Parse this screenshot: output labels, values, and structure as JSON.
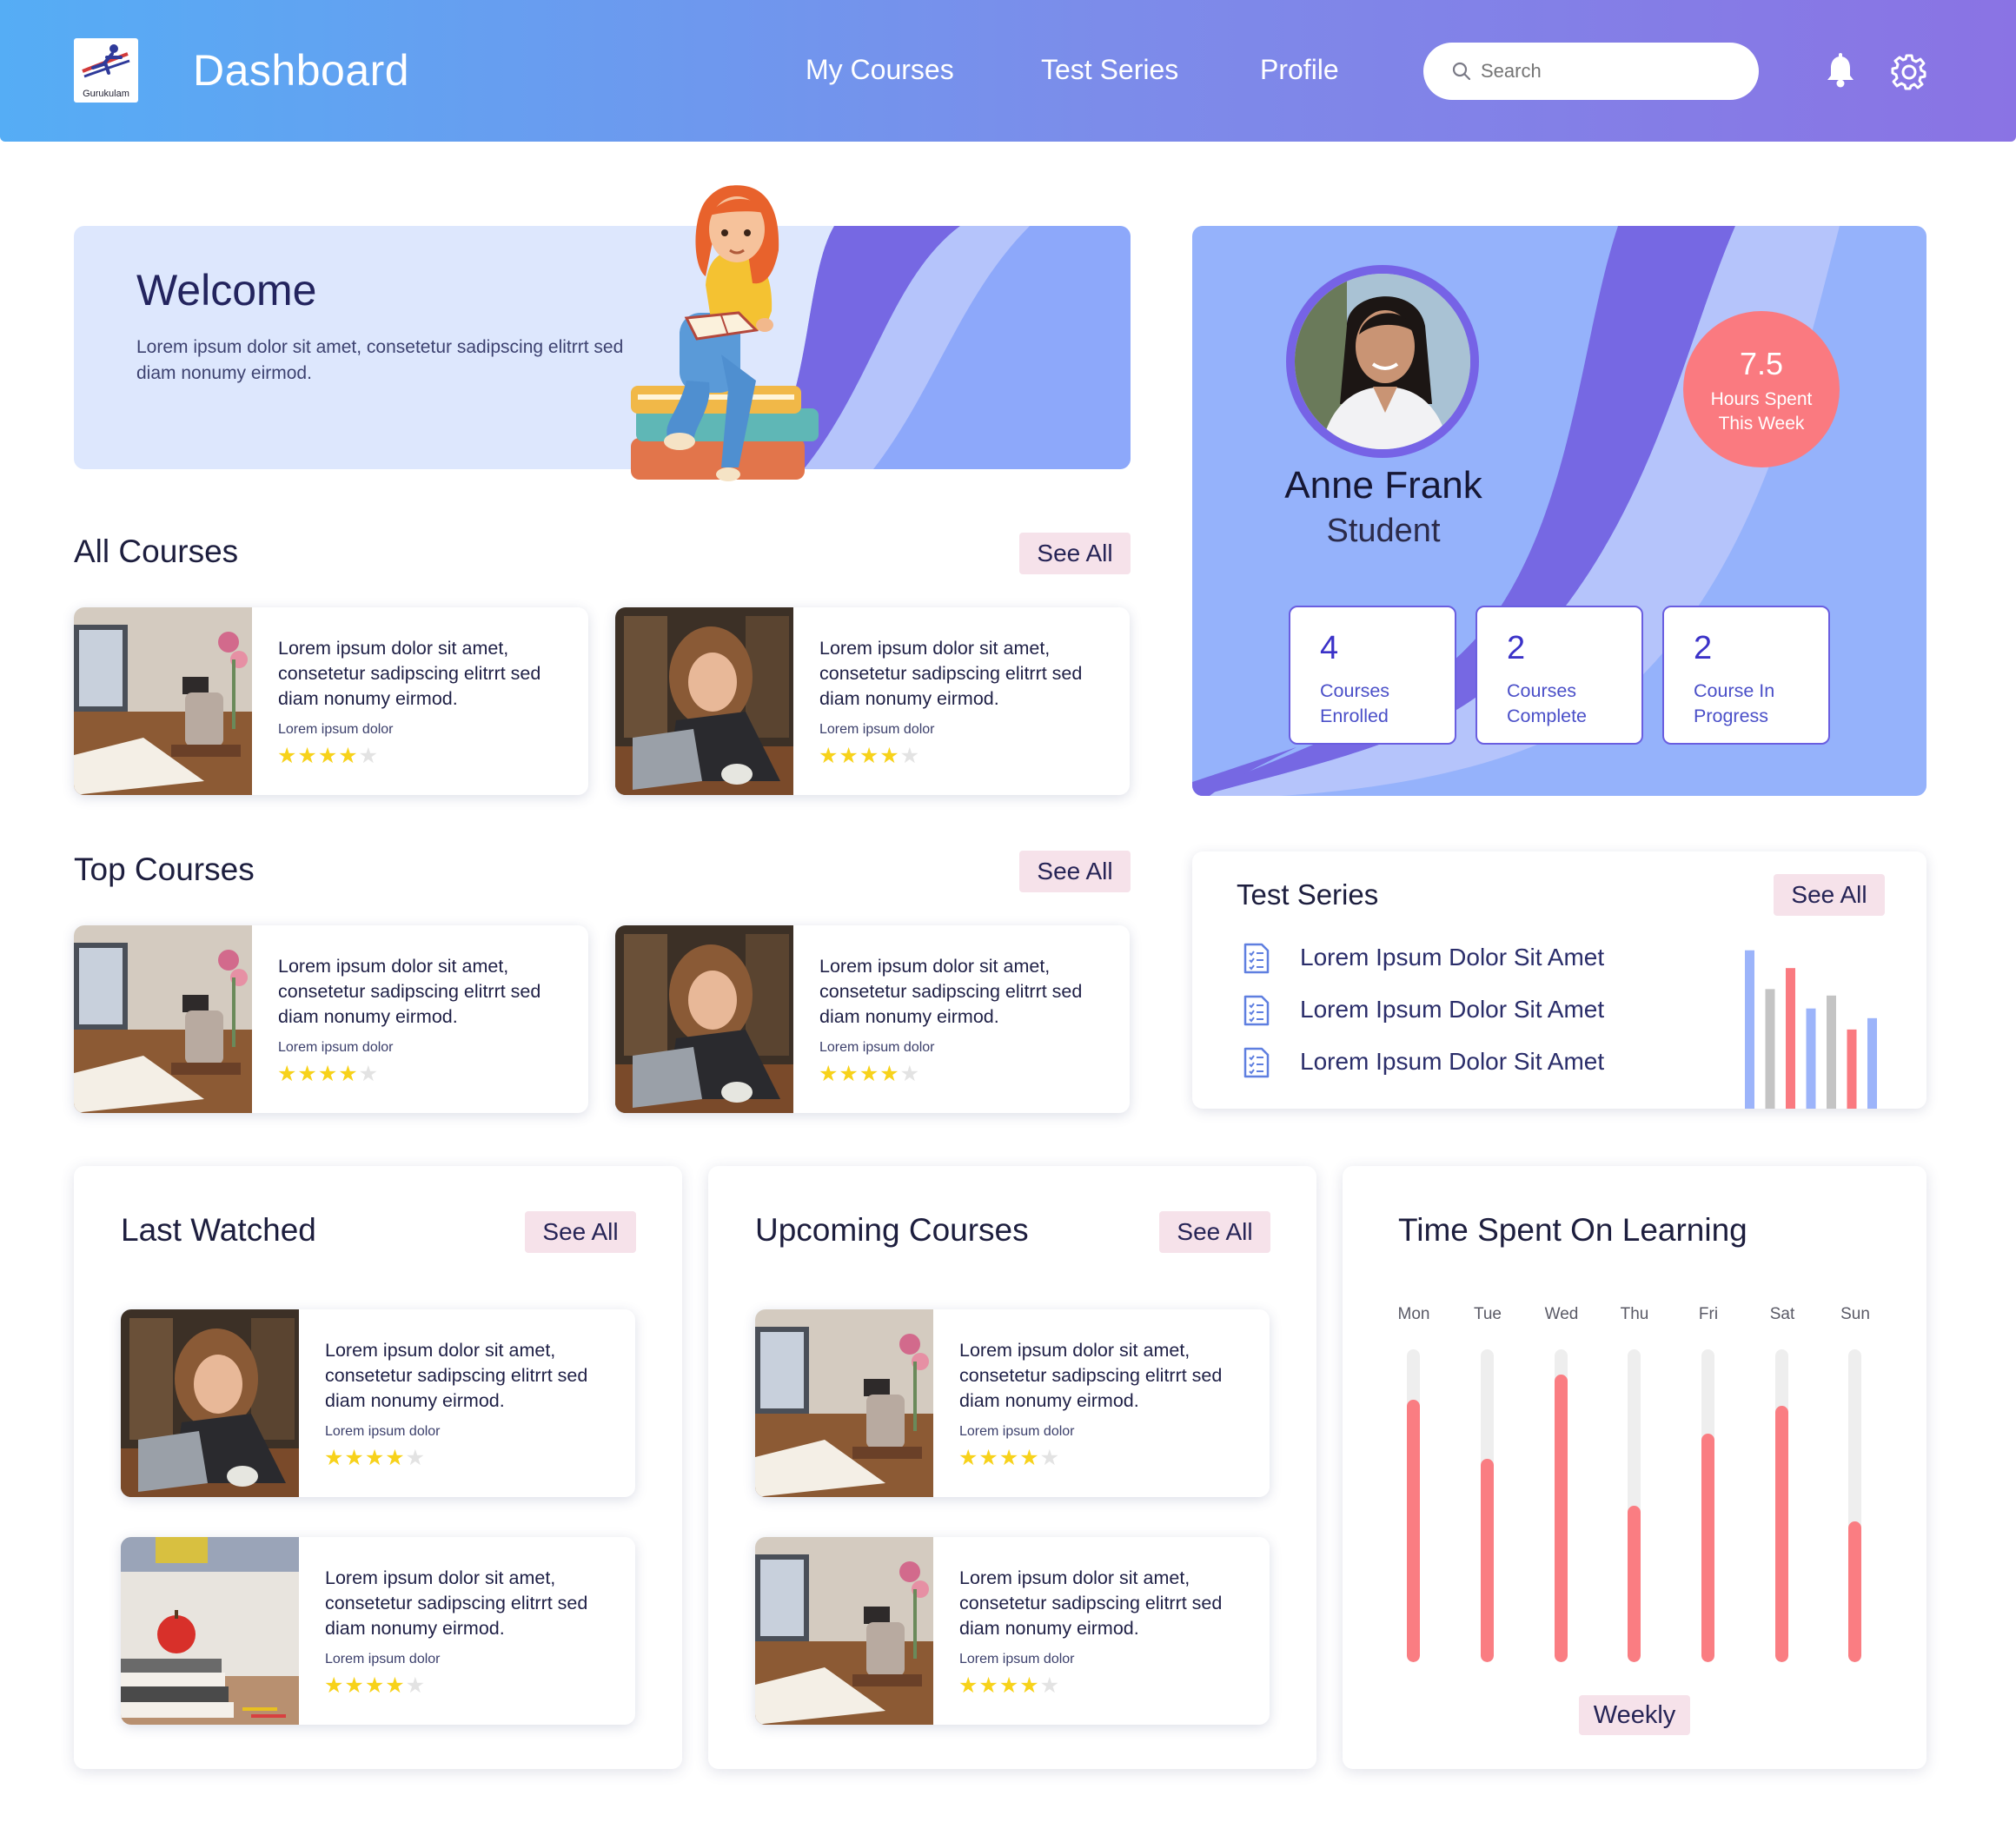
{
  "header": {
    "logo_text": "Gurukulam",
    "title": "Dashboard",
    "nav": [
      "My Courses",
      "Test Series",
      "Profile"
    ],
    "search_placeholder": "Search"
  },
  "welcome": {
    "title": "Welcome",
    "text": "Lorem ipsum dolor sit amet, consetetur sadipscing elitrrt sed diam nonumy eirmod."
  },
  "all_courses": {
    "title": "All Courses",
    "see_all": "See All",
    "cards": [
      {
        "title": "Lorem ipsum dolor sit amet, consetetur sadipscing elitrrt sed diam nonumy eirmod.",
        "subtitle": "Lorem ipsum dolor",
        "rating": 4
      },
      {
        "title": "Lorem ipsum dolor sit amet, consetetur sadipscing elitrrt sed diam nonumy eirmod.",
        "subtitle": "Lorem ipsum dolor",
        "rating": 4
      }
    ]
  },
  "top_courses": {
    "title": "Top Courses",
    "see_all": "See All",
    "cards": [
      {
        "title": "Lorem ipsum dolor sit amet, consetetur sadipscing elitrrt sed diam nonumy eirmod.",
        "subtitle": "Lorem ipsum dolor",
        "rating": 4
      },
      {
        "title": "Lorem ipsum dolor sit amet, consetetur sadipscing elitrrt sed diam nonumy eirmod.",
        "subtitle": "Lorem ipsum dolor",
        "rating": 4
      }
    ]
  },
  "profile": {
    "name": "Anne Frank",
    "role": "Student",
    "hours_value": "7.5",
    "hours_label": "Hours Spent This Week",
    "stats": [
      {
        "value": "4",
        "label": "Courses Enrolled"
      },
      {
        "value": "2",
        "label": "Courses Complete"
      },
      {
        "value": "2",
        "label": "Course In Progress"
      }
    ]
  },
  "test_series": {
    "title": "Test Series",
    "see_all": "See All",
    "items": [
      "Lorem Ipsum Dolor Sit Amet",
      "Lorem Ipsum Dolor Sit Amet",
      "Lorem Ipsum Dolor Sit Amet"
    ],
    "mini_chart": {
      "values": [
        0.98,
        0.74,
        0.87,
        0.62,
        0.7,
        0.49,
        0.56
      ],
      "colors": [
        "#9cb4fa",
        "#c4c4c4",
        "#fa7a80",
        "#9cb4fa",
        "#c4c4c4",
        "#fa7a80",
        "#9cb4fa"
      ]
    }
  },
  "last_watched": {
    "title": "Last Watched",
    "see_all": "See All",
    "cards": [
      {
        "title": "Lorem ipsum dolor sit amet, consetetur sadipscing elitrrt sed diam nonumy eirmod.",
        "subtitle": "Lorem ipsum dolor",
        "rating": 4
      },
      {
        "title": "Lorem ipsum dolor sit amet, consetetur sadipscing elitrrt sed diam nonumy eirmod.",
        "subtitle": "Lorem ipsum dolor",
        "rating": 4
      }
    ]
  },
  "upcoming": {
    "title": "Upcoming Courses",
    "see_all": "See All",
    "cards": [
      {
        "title": "Lorem ipsum dolor sit amet, consetetur sadipscing elitrrt sed diam nonumy eirmod.",
        "subtitle": "Lorem ipsum dolor",
        "rating": 4
      },
      {
        "title": "Lorem ipsum dolor sit amet, consetetur sadipscing elitrrt sed diam nonumy eirmod.",
        "subtitle": "Lorem ipsum dolor",
        "rating": 4
      }
    ]
  },
  "time_spent": {
    "title": "Time Spent On Learning",
    "days": [
      "Mon",
      "Tue",
      "Wed",
      "Thu",
      "Fri",
      "Sat",
      "Sun"
    ],
    "values": [
      0.84,
      0.65,
      0.92,
      0.5,
      0.73,
      0.82,
      0.45
    ],
    "period_button": "Weekly"
  },
  "colors": {
    "header_start": "#55adf5",
    "header_end": "#8a73e4",
    "accent_purple": "#7663e6",
    "accent_coral": "#fa7a80",
    "see_all_bg": "#f6e2ea",
    "star": "#f7d21b"
  }
}
